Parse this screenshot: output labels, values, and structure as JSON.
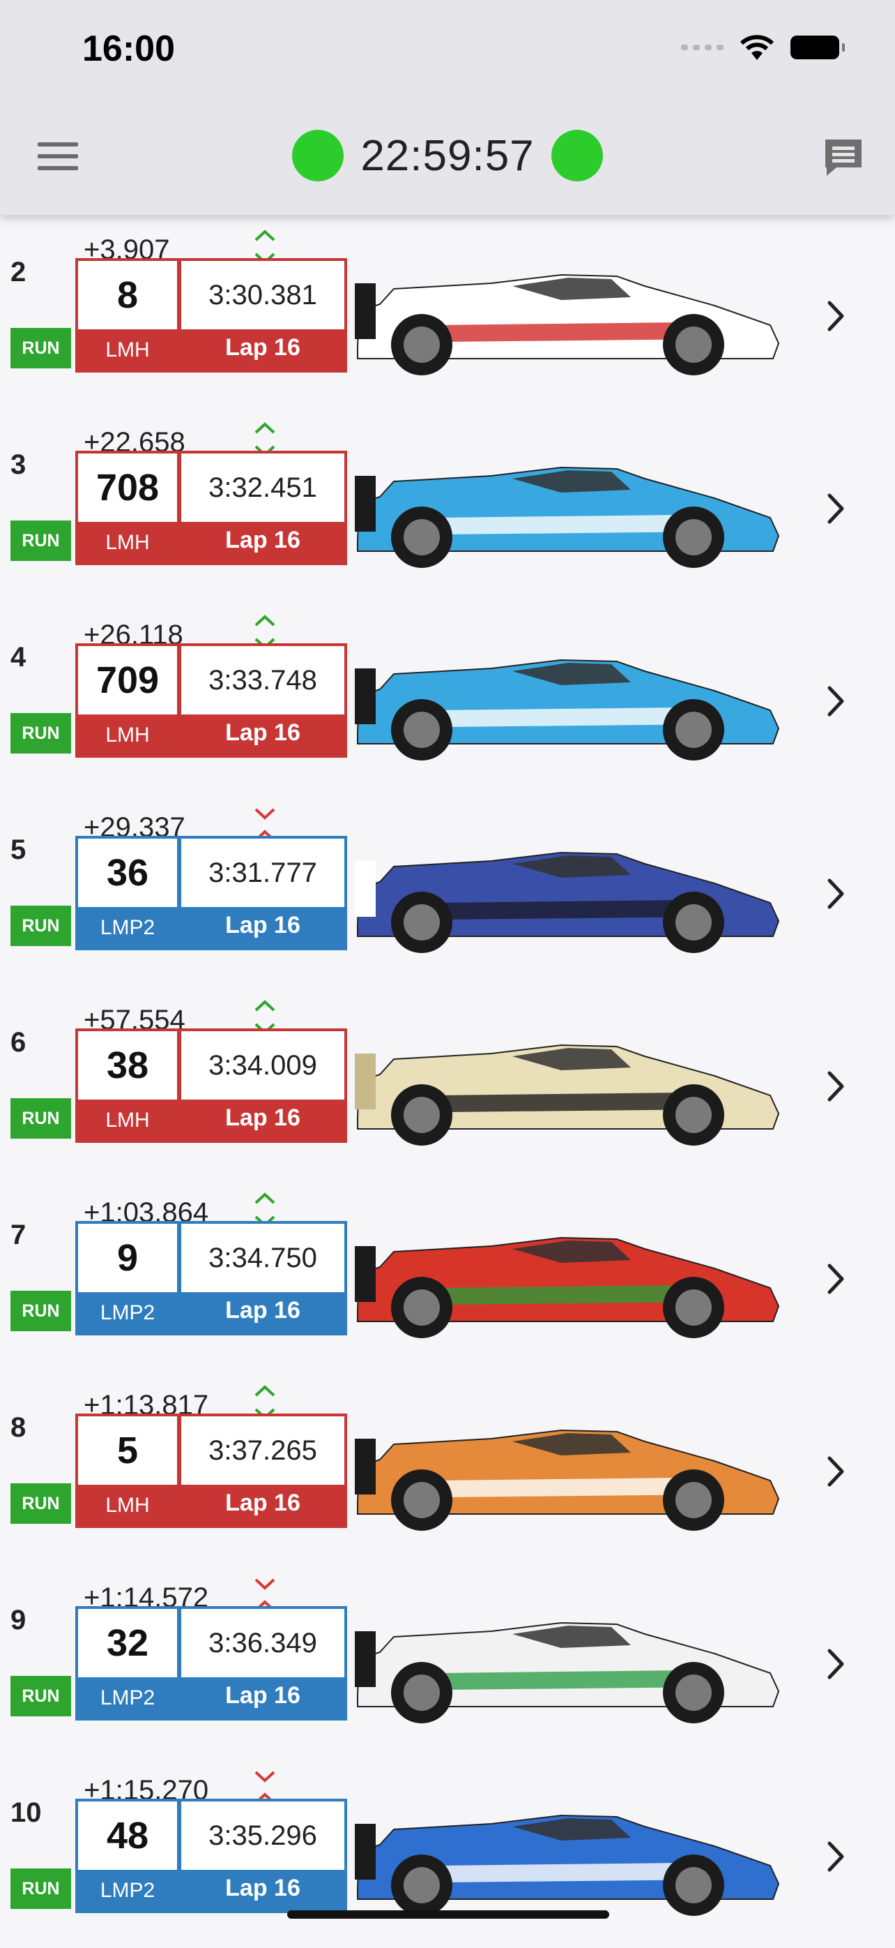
{
  "status_bar": {
    "time": "16:00"
  },
  "header": {
    "race_clock": "22:59:57",
    "flag_color": "#2dcc2d"
  },
  "colors": {
    "lmh": "#c73535",
    "lmp2": "#2f7dbf",
    "run": "#2ea52e",
    "up": "#2ea52e",
    "down": "#d63a3a"
  },
  "leader_gap": {
    "gap": "+3.907",
    "trend": "up"
  },
  "entries": [
    {
      "position": "2",
      "state": "RUN",
      "number": "8",
      "lap_time": "3:30.381",
      "class": "LMH",
      "lap": "Lap 16",
      "car_colors": [
        "#ffffff",
        "#d22a2a",
        "#1b1b1b"
      ],
      "gap": "+22.658",
      "trend": "up"
    },
    {
      "position": "3",
      "state": "RUN",
      "number": "708",
      "lap_time": "3:32.451",
      "class": "LMH",
      "lap": "Lap 16",
      "car_colors": [
        "#39a8e0",
        "#ffffff",
        "#1b1b1b"
      ],
      "gap": "+26.118",
      "trend": "up"
    },
    {
      "position": "4",
      "state": "RUN",
      "number": "709",
      "lap_time": "3:33.748",
      "class": "LMH",
      "lap": "Lap 16",
      "car_colors": [
        "#39a8e0",
        "#ffffff",
        "#1b1b1b"
      ],
      "gap": "+29.337",
      "trend": "down"
    },
    {
      "position": "5",
      "state": "RUN",
      "number": "36",
      "lap_time": "3:31.777",
      "class": "LMP2",
      "lap": "Lap 16",
      "car_colors": [
        "#3a4fa8",
        "#1b1b2e",
        "#ffffff"
      ],
      "gap": "+57.554",
      "trend": "up"
    },
    {
      "position": "6",
      "state": "RUN",
      "number": "38",
      "lap_time": "3:34.009",
      "class": "LMH",
      "lap": "Lap 16",
      "car_colors": [
        "#e9dfb8",
        "#1b1b1b",
        "#c8b98a"
      ],
      "gap": "+1:03.864",
      "trend": "up"
    },
    {
      "position": "7",
      "state": "RUN",
      "number": "9",
      "lap_time": "3:34.750",
      "class": "LMP2",
      "lap": "Lap 16",
      "car_colors": [
        "#d7342a",
        "#2f9a3a",
        "#1b1b1b"
      ],
      "gap": "+1:13.817",
      "trend": "up"
    },
    {
      "position": "8",
      "state": "RUN",
      "number": "5",
      "lap_time": "3:37.265",
      "class": "LMH",
      "lap": "Lap 16",
      "car_colors": [
        "#e48a3a",
        "#ffffff",
        "#1b1b1b"
      ],
      "gap": "+1:14.572",
      "trend": "down"
    },
    {
      "position": "9",
      "state": "RUN",
      "number": "32",
      "lap_time": "3:36.349",
      "class": "LMP2",
      "lap": "Lap 16",
      "car_colors": [
        "#f2f2f2",
        "#2fa04a",
        "#1b1b1b"
      ],
      "gap": "+1:15.270",
      "trend": "down"
    },
    {
      "position": "10",
      "state": "RUN",
      "number": "48",
      "lap_time": "3:35.296",
      "class": "LMP2",
      "lap": "Lap 16",
      "car_colors": [
        "#2f6fd0",
        "#ffffff",
        "#1b1b1b"
      ],
      "gap": "",
      "trend": ""
    }
  ]
}
